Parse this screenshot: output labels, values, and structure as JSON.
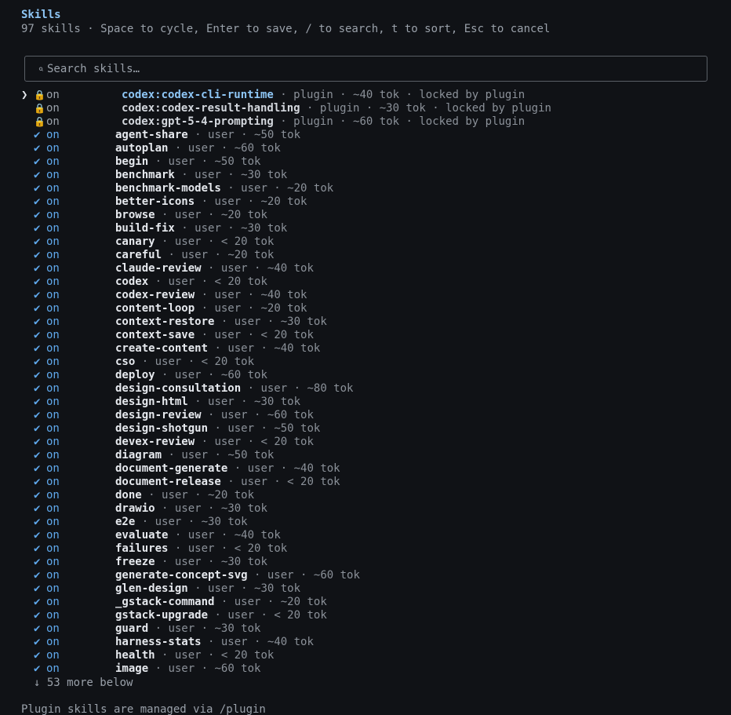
{
  "header": {
    "title": "Skills",
    "subtitle": "97 skills · Space to cycle, Enter to save, / to search, t to sort, Esc to cancel"
  },
  "search": {
    "icon": "search-icon",
    "glyph": "⌕",
    "placeholder": "Search skills…",
    "value": ""
  },
  "list": {
    "cursor_glyph": "❯",
    "check_glyph": "✔",
    "lock_glyph": "🔒",
    "separator": " · ",
    "items": [
      {
        "name": "codex:codex-cli-runtime",
        "state": "on",
        "source": "plugin",
        "tokens": "~40 tok",
        "locked": true,
        "lock_note": "locked by plugin",
        "selected": true
      },
      {
        "name": "codex:codex-result-handling",
        "state": "on",
        "source": "plugin",
        "tokens": "~30 tok",
        "locked": true,
        "lock_note": "locked by plugin"
      },
      {
        "name": "codex:gpt-5-4-prompting",
        "state": "on",
        "source": "plugin",
        "tokens": "~60 tok",
        "locked": true,
        "lock_note": "locked by plugin"
      },
      {
        "name": "agent-share",
        "state": "on",
        "source": "user",
        "tokens": "~50 tok"
      },
      {
        "name": "autoplan",
        "state": "on",
        "source": "user",
        "tokens": "~60 tok"
      },
      {
        "name": "begin",
        "state": "on",
        "source": "user",
        "tokens": "~50 tok"
      },
      {
        "name": "benchmark",
        "state": "on",
        "source": "user",
        "tokens": "~30 tok"
      },
      {
        "name": "benchmark-models",
        "state": "on",
        "source": "user",
        "tokens": "~20 tok"
      },
      {
        "name": "better-icons",
        "state": "on",
        "source": "user",
        "tokens": "~20 tok"
      },
      {
        "name": "browse",
        "state": "on",
        "source": "user",
        "tokens": "~20 tok"
      },
      {
        "name": "build-fix",
        "state": "on",
        "source": "user",
        "tokens": "~30 tok"
      },
      {
        "name": "canary",
        "state": "on",
        "source": "user",
        "tokens": "< 20 tok"
      },
      {
        "name": "careful",
        "state": "on",
        "source": "user",
        "tokens": "~20 tok"
      },
      {
        "name": "claude-review",
        "state": "on",
        "source": "user",
        "tokens": "~40 tok"
      },
      {
        "name": "codex",
        "state": "on",
        "source": "user",
        "tokens": "< 20 tok"
      },
      {
        "name": "codex-review",
        "state": "on",
        "source": "user",
        "tokens": "~40 tok"
      },
      {
        "name": "content-loop",
        "state": "on",
        "source": "user",
        "tokens": "~20 tok"
      },
      {
        "name": "context-restore",
        "state": "on",
        "source": "user",
        "tokens": "~30 tok"
      },
      {
        "name": "context-save",
        "state": "on",
        "source": "user",
        "tokens": "< 20 tok"
      },
      {
        "name": "create-content",
        "state": "on",
        "source": "user",
        "tokens": "~40 tok"
      },
      {
        "name": "cso",
        "state": "on",
        "source": "user",
        "tokens": "< 20 tok"
      },
      {
        "name": "deploy",
        "state": "on",
        "source": "user",
        "tokens": "~60 tok"
      },
      {
        "name": "design-consultation",
        "state": "on",
        "source": "user",
        "tokens": "~80 tok"
      },
      {
        "name": "design-html",
        "state": "on",
        "source": "user",
        "tokens": "~30 tok"
      },
      {
        "name": "design-review",
        "state": "on",
        "source": "user",
        "tokens": "~60 tok"
      },
      {
        "name": "design-shotgun",
        "state": "on",
        "source": "user",
        "tokens": "~50 tok"
      },
      {
        "name": "devex-review",
        "state": "on",
        "source": "user",
        "tokens": "< 20 tok"
      },
      {
        "name": "diagram",
        "state": "on",
        "source": "user",
        "tokens": "~50 tok"
      },
      {
        "name": "document-generate",
        "state": "on",
        "source": "user",
        "tokens": "~40 tok"
      },
      {
        "name": "document-release",
        "state": "on",
        "source": "user",
        "tokens": "< 20 tok"
      },
      {
        "name": "done",
        "state": "on",
        "source": "user",
        "tokens": "~20 tok"
      },
      {
        "name": "drawio",
        "state": "on",
        "source": "user",
        "tokens": "~30 tok"
      },
      {
        "name": "e2e",
        "state": "on",
        "source": "user",
        "tokens": "~30 tok"
      },
      {
        "name": "evaluate",
        "state": "on",
        "source": "user",
        "tokens": "~40 tok"
      },
      {
        "name": "failures",
        "state": "on",
        "source": "user",
        "tokens": "< 20 tok"
      },
      {
        "name": "freeze",
        "state": "on",
        "source": "user",
        "tokens": "~30 tok"
      },
      {
        "name": "generate-concept-svg",
        "state": "on",
        "source": "user",
        "tokens": "~60 tok"
      },
      {
        "name": "glen-design",
        "state": "on",
        "source": "user",
        "tokens": "~30 tok"
      },
      {
        "name": "_gstack-command",
        "state": "on",
        "source": "user",
        "tokens": "~20 tok"
      },
      {
        "name": "gstack-upgrade",
        "state": "on",
        "source": "user",
        "tokens": "< 20 tok"
      },
      {
        "name": "guard",
        "state": "on",
        "source": "user",
        "tokens": "~30 tok"
      },
      {
        "name": "harness-stats",
        "state": "on",
        "source": "user",
        "tokens": "~40 tok"
      },
      {
        "name": "health",
        "state": "on",
        "source": "user",
        "tokens": "< 20 tok"
      },
      {
        "name": "image",
        "state": "on",
        "source": "user",
        "tokens": "~60 tok"
      }
    ],
    "more_below": "↓ 53 more below"
  },
  "footer": {
    "text": "Plugin skills are managed via /plugin"
  },
  "colors": {
    "background": "#101216",
    "accent": "#8ec6f5",
    "check": "#5fa8ec",
    "lock": "#d8a64a",
    "muted": "#8b9199"
  }
}
